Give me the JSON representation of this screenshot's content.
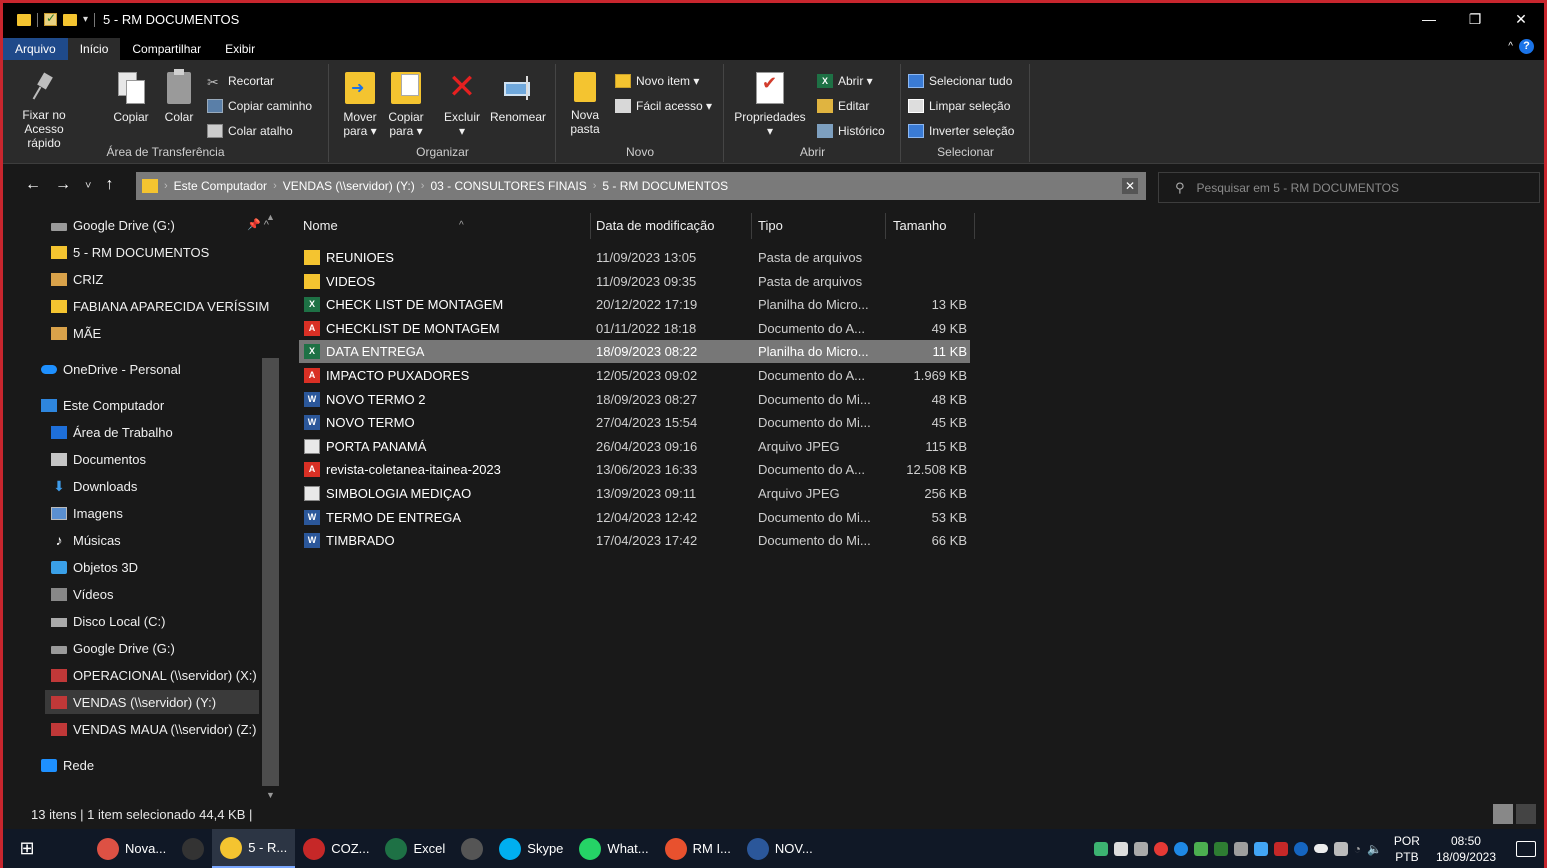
{
  "window": {
    "title": "5 - RM DOCUMENTOS",
    "controls": [
      "—",
      "❐",
      "✕"
    ]
  },
  "ribbon_tabs": [
    "Arquivo",
    "Início",
    "Compartilhar",
    "Exibir"
  ],
  "ribbon": {
    "clipboard": {
      "label": "Área de Transferência",
      "pin_line1": "Fixar no",
      "pin_line2": "Acesso rápido",
      "copy": "Copiar",
      "paste": "Colar",
      "cut": "Recortar",
      "copy_path": "Copiar caminho",
      "paste_shortcut": "Colar atalho"
    },
    "organize": {
      "label": "Organizar",
      "move_line1": "Mover",
      "move_line2": "para ▾",
      "copy_line1": "Copiar",
      "copy_line2": "para ▾",
      "delete": "Excluir",
      "delete_caret": "▾",
      "rename": "Renomear"
    },
    "new": {
      "label": "Novo",
      "new_folder_line1": "Nova",
      "new_folder_line2": "pasta",
      "new_item": "Novo item ▾",
      "easy_access": "Fácil acesso ▾"
    },
    "open": {
      "label": "Abrir",
      "properties": "Propriedades",
      "properties_caret": "▾",
      "open": "Abrir ▾",
      "edit": "Editar",
      "history": "Histórico"
    },
    "select": {
      "label": "Selecionar",
      "select_all": "Selecionar tudo",
      "clear_selection": "Limpar seleção",
      "invert_selection": "Inverter seleção"
    }
  },
  "nav": {
    "back": "←",
    "forward": "→",
    "recent": "˅",
    "up": "↑"
  },
  "address": {
    "crumbs": [
      "Este Computador",
      "VENDAS (\\\\servidor) (Y:)",
      "03 - CONSULTORES FINAIS",
      "5 - RM DOCUMENTOS"
    ],
    "clear": "✕"
  },
  "search": {
    "placeholder": "Pesquisar em 5 - RM DOCUMENTOS"
  },
  "sidebar": [
    {
      "label": "Google Drive (G:)",
      "icon": "drive-icon"
    },
    {
      "label": "5 - RM DOCUMENTOS",
      "icon": "folder-icon"
    },
    {
      "label": "CRIZ",
      "icon": "user-folder-icon"
    },
    {
      "label": "FABIANA APARECIDA VERÍSSIM",
      "icon": "folder-icon"
    },
    {
      "label": "MÃE",
      "icon": "user-folder-icon"
    },
    {
      "label": "OneDrive - Personal",
      "icon": "cloud-icon"
    },
    {
      "label": "Este Computador",
      "icon": "computer-icon"
    },
    {
      "label": "Área de Trabalho",
      "icon": "desktop-icon"
    },
    {
      "label": "Documentos",
      "icon": "documents-icon"
    },
    {
      "label": "Downloads",
      "icon": "download-icon"
    },
    {
      "label": "Imagens",
      "icon": "images-icon"
    },
    {
      "label": "Músicas",
      "icon": "music-icon"
    },
    {
      "label": "Objetos 3D",
      "icon": "3d-objects-icon"
    },
    {
      "label": "Vídeos",
      "icon": "videos-icon"
    },
    {
      "label": "Disco Local (C:)",
      "icon": "hard-disk-icon"
    },
    {
      "label": "Google Drive (G:)",
      "icon": "drive-icon"
    },
    {
      "label": "OPERACIONAL (\\\\servidor) (X:)",
      "icon": "network-drive-icon"
    },
    {
      "label": "VENDAS (\\\\servidor) (Y:)",
      "icon": "network-drive-icon"
    },
    {
      "label": "VENDAS MAUA (\\\\servidor) (Z:)",
      "icon": "network-drive-icon"
    },
    {
      "label": "Rede",
      "icon": "network-icon"
    }
  ],
  "columns": {
    "name": "Nome",
    "date": "Data de modificação",
    "type": "Tipo",
    "size": "Tamanho"
  },
  "files": [
    {
      "name": "REUNIOES",
      "date": "11/09/2023 13:05",
      "type": "Pasta de arquivos",
      "size": "",
      "icon": "folder"
    },
    {
      "name": "VIDEOS",
      "date": "11/09/2023 09:35",
      "type": "Pasta de arquivos",
      "size": "",
      "icon": "folder"
    },
    {
      "name": "CHECK LIST DE MONTAGEM",
      "date": "20/12/2022 17:19",
      "type": "Planilha do Micro...",
      "size": "13 KB",
      "icon": "excel"
    },
    {
      "name": "CHECKLIST DE MONTAGEM",
      "date": "01/11/2022 18:18",
      "type": "Documento do A...",
      "size": "49 KB",
      "icon": "pdf"
    },
    {
      "name": "DATA ENTREGA",
      "date": "18/09/2023 08:22",
      "type": "Planilha do Micro...",
      "size": "11 KB",
      "icon": "excel"
    },
    {
      "name": "IMPACTO PUXADORES",
      "date": "12/05/2023 09:02",
      "type": "Documento do A...",
      "size": "1.969 KB",
      "icon": "pdf"
    },
    {
      "name": "NOVO TERMO 2",
      "date": "18/09/2023 08:27",
      "type": "Documento do Mi...",
      "size": "48 KB",
      "icon": "word"
    },
    {
      "name": "NOVO TERMO",
      "date": "27/04/2023 15:54",
      "type": "Documento do Mi...",
      "size": "45 KB",
      "icon": "word"
    },
    {
      "name": "PORTA PANAMÁ",
      "date": "26/04/2023 09:16",
      "type": "Arquivo JPEG",
      "size": "115 KB",
      "icon": "jpeg"
    },
    {
      "name": "revista-coletanea-itainea-2023",
      "date": "13/06/2023 16:33",
      "type": "Documento do A...",
      "size": "12.508 KB",
      "icon": "pdf"
    },
    {
      "name": "SIMBOLOGIA MEDIÇAO",
      "date": "13/09/2023 09:11",
      "type": "Arquivo JPEG",
      "size": "256 KB",
      "icon": "jpeg"
    },
    {
      "name": "TERMO DE ENTREGA",
      "date": "12/04/2023 12:42",
      "type": "Documento do Mi...",
      "size": "53 KB",
      "icon": "word"
    },
    {
      "name": "TIMBRADO",
      "date": "17/04/2023 17:42",
      "type": "Documento do Mi...",
      "size": "66 KB",
      "icon": "word"
    }
  ],
  "selected_file": "DATA ENTREGA",
  "status": {
    "text": "13 itens  |  1 item selecionado  44,4 KB  |"
  },
  "taskbar": {
    "items": [
      {
        "label": "Nova...",
        "icon": "chrome-icon",
        "color": "#dd5144"
      },
      {
        "label": "",
        "icon": "media-player-icon",
        "color": "#333"
      },
      {
        "label": "5 - R...",
        "icon": "file-explorer-icon",
        "color": "#f4c430"
      },
      {
        "label": "COZ...",
        "icon": "cad-app-icon",
        "color": "#c62828"
      },
      {
        "label": "Excel",
        "icon": "excel-icon",
        "color": "#1e7145"
      },
      {
        "label": "",
        "icon": "calculator-icon",
        "color": "#555"
      },
      {
        "label": "Skype",
        "icon": "skype-icon",
        "color": "#00aff0"
      },
      {
        "label": "What...",
        "icon": "whatsapp-icon",
        "color": "#25d366"
      },
      {
        "label": "RM I...",
        "icon": "rm-app-icon",
        "color": "#e8512e"
      },
      {
        "label": "NOV...",
        "icon": "word-icon",
        "color": "#2b579a"
      }
    ],
    "lang_line1": "POR",
    "lang_line2": "PTB",
    "time": "08:50",
    "date": "18/09/2023"
  }
}
